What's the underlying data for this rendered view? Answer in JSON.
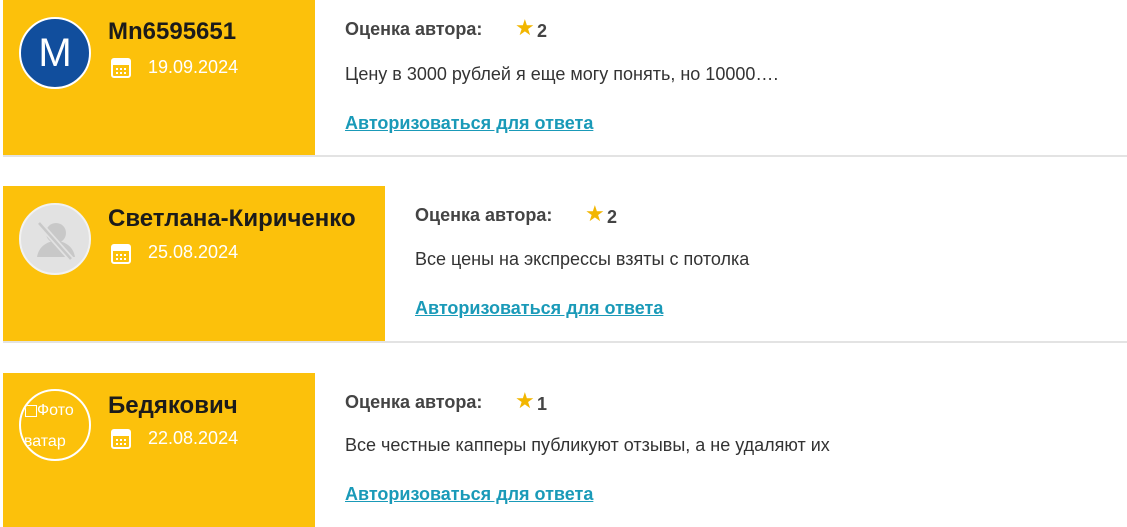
{
  "reviews": [
    {
      "avatar_letter": "M",
      "author": "Mn6595651",
      "date": "19.09.2024",
      "rating_label": "Оценка автора:",
      "rating": "2",
      "comment": "Цену в 3000 рублей я еще могу понять, но 10000….",
      "reply_link": "Авторизоваться для ответа"
    },
    {
      "author": "Светлана-Кириченко",
      "date": "25.08.2024",
      "rating_label": "Оценка автора:",
      "rating": "2",
      "comment": "Все цены на экспрессы взяты с потолка",
      "reply_link": "Авторизоваться для ответа"
    },
    {
      "avatar_alt_line1": "Фото",
      "avatar_alt_line2": "аватар",
      "author": "Бедякович",
      "date": "22.08.2024",
      "rating_label": "Оценка автора:",
      "rating": "1",
      "comment": "Все честные капперы публикуют отзывы, а не удаляют их",
      "reply_link": "Авторизоваться для ответа"
    }
  ],
  "colors": {
    "author_block": "#fcc10b",
    "star": "#f2b600",
    "link": "#1a9ab8",
    "avatar_m": "#114e9d"
  },
  "icons": [
    "calendar-icon",
    "star-icon",
    "no-avatar-icon"
  ]
}
